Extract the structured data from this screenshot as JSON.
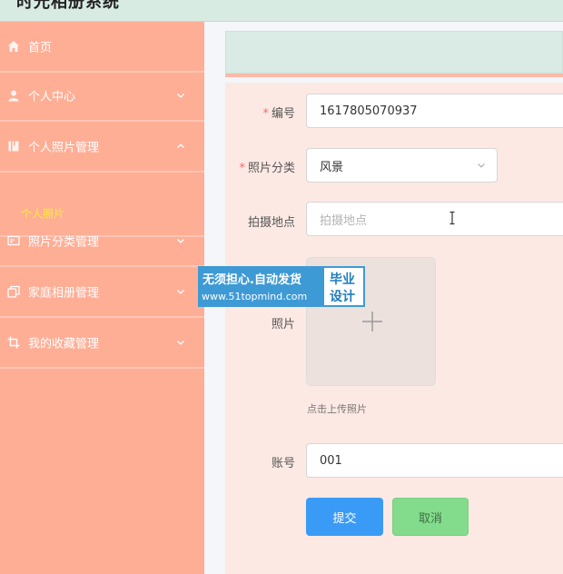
{
  "app": {
    "title": "时光相册系统"
  },
  "sidebar": {
    "items": [
      {
        "label": "首页",
        "icon": "home-icon"
      },
      {
        "label": "个人中心",
        "icon": "user-icon",
        "chevron": "down"
      },
      {
        "label": "个人照片管理",
        "icon": "book-icon",
        "chevron": "up",
        "expanded": true
      },
      {
        "label": "照片分类管理",
        "icon": "card-icon",
        "chevron": "down"
      },
      {
        "label": "家庭相册管理",
        "icon": "copy-icon",
        "chevron": "down"
      },
      {
        "label": "我的收藏管理",
        "icon": "crop-icon",
        "chevron": "down"
      }
    ],
    "subitems": [
      {
        "label": "个人照片",
        "color": "#ffee33"
      }
    ]
  },
  "form": {
    "number": {
      "label": "编号",
      "required": true,
      "value": "1617805070937"
    },
    "category": {
      "label": "照片分类",
      "required": true,
      "value": "风景"
    },
    "location": {
      "label": "拍摄地点",
      "required": false,
      "value": "",
      "placeholder": "拍摄地点"
    },
    "photo": {
      "label": "照片",
      "hint": "点击上传照片"
    },
    "account": {
      "label": "账号",
      "required": false,
      "value": "001"
    }
  },
  "buttons": {
    "submit": "提交",
    "cancel": "取消"
  },
  "watermark": {
    "line1": "无须担心.自动发货",
    "line2": "www.51topmind.com",
    "right1": "毕业",
    "right2": "设计"
  },
  "colors": {
    "sidebar": "#ffae96",
    "submit": "#3a9bf7",
    "cancel": "#83dc8c",
    "required": "#f56c6c",
    "active_sub": "#ffee33"
  }
}
